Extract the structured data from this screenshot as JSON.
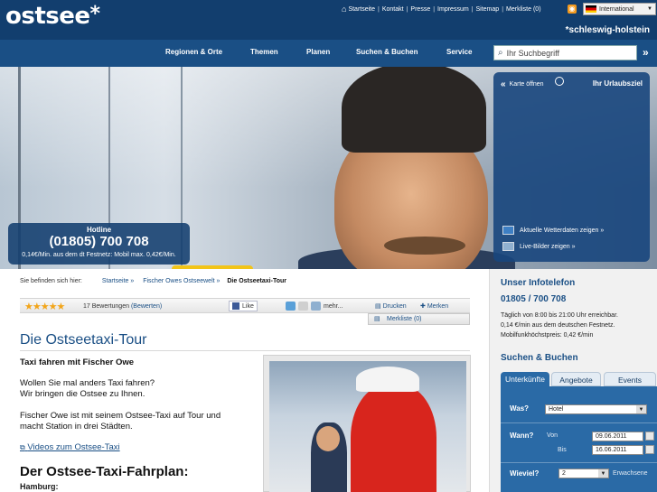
{
  "brand": {
    "logo": "ostsee",
    "logo_star": "*",
    "subbrand": "*schleswig-holstein"
  },
  "topnav": {
    "items": [
      "Startseite",
      "Kontakt",
      "Presse",
      "Impressum",
      "Sitemap",
      "Merkliste (0)"
    ],
    "language": "International"
  },
  "mainnav": {
    "items": [
      "Regionen & Orte",
      "Themen",
      "Planen",
      "Suchen & Buchen",
      "Service"
    ]
  },
  "search": {
    "placeholder": "Ihr Suchbegriff"
  },
  "hero": {
    "hotline_title": "Hotline",
    "hotline_number": "(01805) 700 708",
    "hotline_price": "0,14€/Min. aus dem dt Festnetz: Mobil max. 0,42€/Min.",
    "map_open": "Karte öffnen",
    "map_title": "Ihr Urlaubsziel",
    "weather_link": "Aktuelle Wetterdaten zeigen »",
    "live_link": "Live-Bilder zeigen »"
  },
  "breadcrumb": {
    "prefix": "Sie befinden sich hier:",
    "items": [
      "Startseite »",
      "Fischer Owes Ostseewelt »"
    ],
    "current": "Die Ostseetaxi-Tour"
  },
  "toolbar": {
    "stars": "★★★★★",
    "reviews": "17 Bewertungen",
    "reviews_link": "(Bewerten)",
    "like": "Like",
    "more": "mehr...",
    "print": "Drucken",
    "remember": "Merken",
    "wishlist": "Merkliste (0)"
  },
  "article": {
    "title": "Die Ostseetaxi-Tour",
    "subtitle": "Taxi fahren mit Fischer Owe",
    "para1_l1": "Wollen Sie mal anders Taxi fahren?",
    "para1_l2": "Wir bringen die Ostsee zu Ihnen.",
    "para2_l1": "Fischer Owe ist mit seinem Ostsee-Taxi auf Tour und",
    "para2_l2": "macht Station in drei Städten.",
    "video_link": "Videos zum Ostsee-Taxi",
    "schedule_title": "Der Ostsee-Taxi-Fahrplan:",
    "city": "Hamburg:"
  },
  "sidebar": {
    "phone_title": "Unser Infotelefon",
    "phone_number": "01805 / 700 708",
    "info_l1": "Täglich von 8:00 bis 21:00 Uhr erreichbar.",
    "info_l2": "0,14 €/min aus dem deutschen Festnetz.",
    "info_l3": "Mobilfunkhöchstpreis: 0,42 €/min",
    "search_title": "Suchen & Buchen",
    "tabs": [
      "Unterkünfte",
      "Angebote",
      "Events"
    ],
    "what_label": "Was?",
    "what_value": "Hotel",
    "when_label": "Wann?",
    "from_label": "Von",
    "from_value": "09.06.2011",
    "to_label": "Bis",
    "to_value": "16.06.2011",
    "howmany_label": "Wieviel?",
    "howmany_value": "2",
    "adults_label": "Erwachsene"
  },
  "colors": {
    "header": "#123e6e",
    "nav": "#1a4f85",
    "link": "#1a4f85",
    "star": "#f2a51a",
    "search_box": "#2a6aa6"
  }
}
